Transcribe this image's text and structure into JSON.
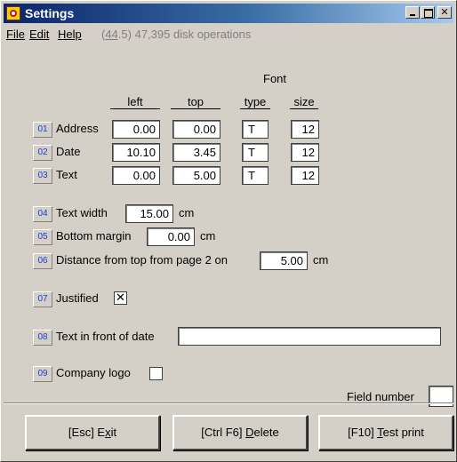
{
  "window": {
    "title": "Settings",
    "close_glyph": "✕"
  },
  "menu": {
    "file": "File",
    "edit": "Edit",
    "help": "Help",
    "status_prefix": "(",
    "status_ul": "44",
    "status_rest": ".5) 47,395 disk operations"
  },
  "table": {
    "font_header": "Font",
    "columns": {
      "left": "left",
      "top": "top",
      "type": "type",
      "size": "size"
    },
    "rows": [
      {
        "num": "01",
        "label": "Address",
        "left": "0.00",
        "top": "0.00",
        "type": "T",
        "size": "12"
      },
      {
        "num": "02",
        "label": "Date",
        "left": "10.10",
        "top": "3.45",
        "type": "T",
        "size": "12"
      },
      {
        "num": "03",
        "label": "Text",
        "left": "0.00",
        "top": "5.00",
        "type": "T",
        "size": "12"
      }
    ]
  },
  "text_width": {
    "num": "04",
    "label": "Text width",
    "value": "15.00",
    "unit": "cm"
  },
  "bottom_margin": {
    "num": "05",
    "label": "Bottom margin",
    "value": "0.00",
    "unit": "cm"
  },
  "distance_top": {
    "num": "06",
    "label": "Distance from top from page 2 on",
    "value": "5.00",
    "unit": "cm"
  },
  "justified": {
    "num": "07",
    "label": "Justified",
    "checked": true,
    "mark": "✕"
  },
  "text_front_date": {
    "num": "08",
    "label": "Text in front of date",
    "value": ""
  },
  "company_logo": {
    "num": "09",
    "label": "Company logo",
    "checked": false,
    "mark": ""
  },
  "field_number": {
    "label": "Field number",
    "value": ""
  },
  "buttons": {
    "exit_prefix": "[Esc] E",
    "exit_ul": "x",
    "exit_rest": "it",
    "delete_prefix": "[Ctrl F6] ",
    "delete_ul": "D",
    "delete_rest": "elete",
    "test_prefix": "[F10] ",
    "test_ul": "T",
    "test_rest": "est print"
  }
}
